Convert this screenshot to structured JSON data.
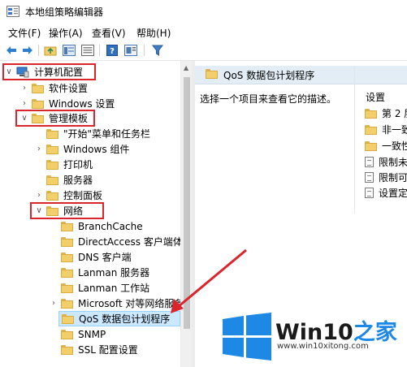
{
  "window": {
    "title": "本地组策略编辑器"
  },
  "menu": [
    "文件(F)",
    "操作(A)",
    "查看(V)",
    "帮助(H)"
  ],
  "tree": {
    "computer_config": "计算机配置",
    "software_settings": "软件设置",
    "windows_settings": "Windows 设置",
    "admin_templates": "管理模板",
    "start_menu": "\"开始\"菜单和任务栏",
    "windows_components": "Windows 组件",
    "printers": "打印机",
    "server": "服务器",
    "control_panel": "控制面板",
    "network": "网络",
    "network_items": [
      "BranchCache",
      "DirectAccess 客户端体验",
      "DNS 客户端",
      "Lanman 服务器",
      "Lanman 工作站",
      "Microsoft 对等网络服务",
      "QoS 数据包计划程序",
      "SNMP",
      "SSL 配置设置"
    ]
  },
  "right_pane": {
    "header": "QoS 数据包计划程序",
    "description": "选择一个项目来查看它的描述。",
    "column": "设置",
    "items": [
      "第 2 层",
      "非一致",
      "一致性",
      "限制未",
      "限制可",
      "设置定"
    ]
  },
  "watermark": {
    "brand": "Win10",
    "brand_suffix": "之家",
    "url": "www.win10xitong.com"
  },
  "colors": {
    "annotation_red": "#d9252b",
    "selection": "#cce8ff",
    "win_blue": "#1e88e5"
  }
}
